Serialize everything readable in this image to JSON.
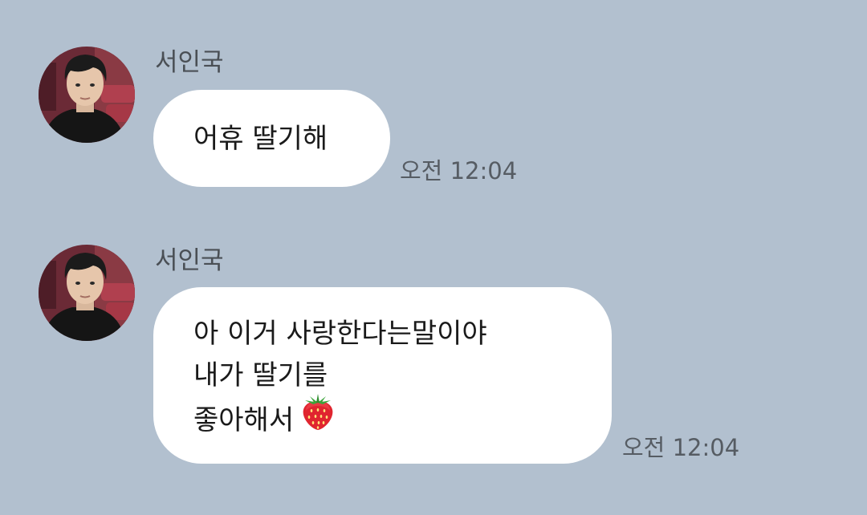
{
  "chat": {
    "messages": [
      {
        "sender": "서인국",
        "avatar": "profile-photo",
        "lines": [
          "어휴 딸기해"
        ],
        "time": "오전 12:04"
      },
      {
        "sender": "서인국",
        "avatar": "profile-photo",
        "lines": [
          "아 이거 사랑한다는말이야",
          "내가 딸기를",
          "좋아해서"
        ],
        "emoji": "strawberry",
        "time": "오전 12:04"
      }
    ]
  },
  "colors": {
    "background": "#b2c0cf",
    "bubble": "#ffffff",
    "text": "#1a1a1a",
    "secondary_text": "#565c63"
  }
}
